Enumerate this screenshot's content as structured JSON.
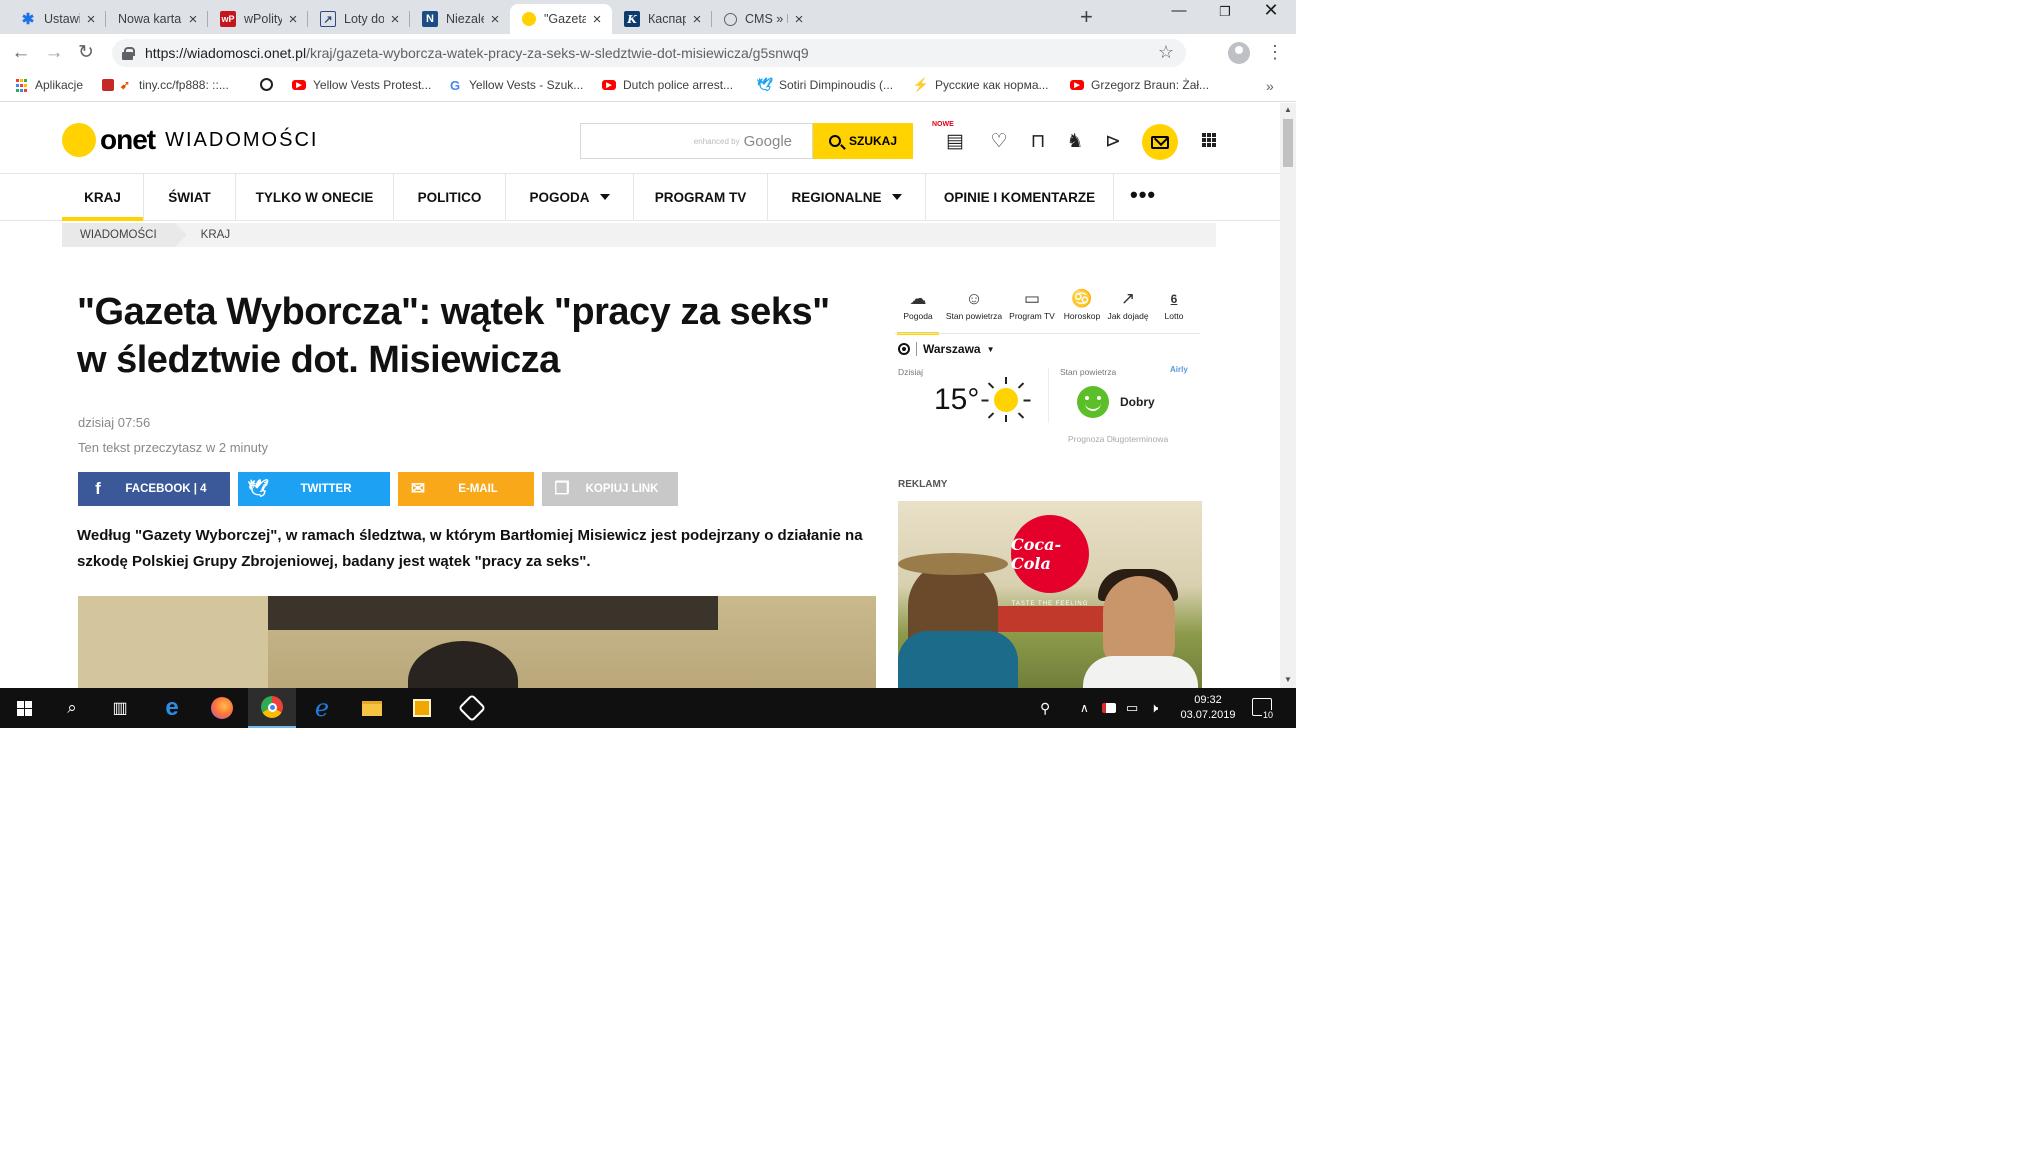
{
  "browser": {
    "tabs": [
      {
        "title": "Ustawienia",
        "icon": "gear-icon",
        "color": "#1a73e8"
      },
      {
        "title": "Nowa karta",
        "icon": "blank-icon",
        "color": "#ffffff"
      },
      {
        "title": "wPolityce.pl",
        "icon": "wp-icon",
        "color": "#c4161c"
      },
      {
        "title": "Loty do Tokio",
        "icon": "flight-icon",
        "color": "#2d4b86"
      },
      {
        "title": "Niezależna",
        "icon": "n-icon",
        "color": "#1c4b85"
      },
      {
        "title": "\"Gazeta Wyborcza\"",
        "icon": "onet-icon",
        "color": "#ffd200"
      },
      {
        "title": "Каспаров.Ru",
        "icon": "k-icon",
        "color": "#0d3b6e"
      },
      {
        "title": "CMS » Dodaj",
        "icon": "globe-icon",
        "color": "#5f6368"
      }
    ],
    "active_tab": 5,
    "url_host": "https://wiadomosci.onet.pl",
    "url_path": "/kraj/gazeta-wyborcza-watek-pracy-za-seks-w-sledztwie-dot-misiewicza/g5snwq9",
    "bookmarks": [
      {
        "label": "Aplikacje",
        "icon": "apps-icon",
        "color": "#ea4335"
      },
      {
        "label": "tiny.cc/fp888: ::...",
        "icon": "bookmark-icon",
        "color": "#e65100"
      },
      {
        "label": "",
        "icon": "globe-icon",
        "color": "#202124"
      },
      {
        "label": "Yellow Vests Protest...",
        "icon": "youtube-icon",
        "color": "#ff0000"
      },
      {
        "label": "Yellow Vests - Szuk...",
        "icon": "google-icon",
        "color": "#4285f4"
      },
      {
        "label": "Dutch police arrest...",
        "icon": "youtube-icon",
        "color": "#ff0000"
      },
      {
        "label": "Sotiri Dimpinoudis (...",
        "icon": "twitter-icon",
        "color": "#1da1f2"
      },
      {
        "label": "Русские как норма...",
        "icon": "bookmark-icon",
        "color": "#f57c00"
      },
      {
        "label": "Grzegorz Braun: Żał...",
        "icon": "youtube-icon",
        "color": "#ff0000"
      }
    ]
  },
  "site": {
    "logo_word": "onet",
    "logo_section": "WIADOMOŚCI",
    "search_enhanced": "enhanced by",
    "search_google": "Google",
    "search_button": "SZUKAJ",
    "nowe_badge": "NOWE",
    "nav": [
      {
        "label": "KRAJ",
        "active": true,
        "dropdown": false
      },
      {
        "label": "ŚWIAT",
        "active": false,
        "dropdown": false
      },
      {
        "label": "TYLKO W ONECIE",
        "active": false,
        "dropdown": false
      },
      {
        "label": "POLITICO",
        "active": false,
        "dropdown": false
      },
      {
        "label": "POGODA",
        "active": false,
        "dropdown": true
      },
      {
        "label": "PROGRAM TV",
        "active": false,
        "dropdown": false
      },
      {
        "label": "REGIONALNE",
        "active": false,
        "dropdown": true
      },
      {
        "label": "OPINIE I KOMENTARZE",
        "active": false,
        "dropdown": false
      }
    ],
    "nav_more": "•••",
    "accent": "#ffd200"
  },
  "breadcrumb": [
    "WIADOMOŚCI",
    "KRAJ"
  ],
  "article": {
    "title": "\"Gazeta Wyborcza\": wątek \"pracy za seks\" w śledztwie dot. Misiewicza",
    "date": "dzisiaj 07:56",
    "read_time": "Ten tekst przeczytasz w 2 minuty",
    "share": {
      "facebook": "FACEBOOK | 4",
      "twitter": "TWITTER",
      "email": "E-MAIL",
      "copy": "KOPIUJ LINK"
    },
    "lead": "Według \"Gazety Wyborczej\", w ramach śledztwa, w którym Bartłomiej Misiewicz jest podejrzany o działanie na szkodę Polskiej Grupy Zbrojeniowej, badany jest wątek \"pracy za seks\"."
  },
  "widget": {
    "tabs": [
      {
        "label": "Pogoda",
        "icon": "weather-icon"
      },
      {
        "label": "Stan powietrza",
        "icon": "air-quality-icon"
      },
      {
        "label": "Program TV",
        "icon": "tv-icon"
      },
      {
        "label": "Horoskop",
        "icon": "horoscope-icon"
      },
      {
        "label": "Jak dojadę",
        "icon": "route-icon"
      },
      {
        "label": "Lotto",
        "icon": "lotto-icon"
      }
    ],
    "lotto_number": "6",
    "city": "Warszawa",
    "today_label": "Dzisiaj",
    "temperature": "15°",
    "air_label": "Stan powietrza",
    "air_value": "Dobry",
    "airly": "Airly",
    "forecast_link": "Prognoza Długoterminowa"
  },
  "ads": {
    "label": "REKLAMY",
    "brand": "Coca-Cola",
    "tagline": "TASTE THE FEELING"
  },
  "taskbar": {
    "time": "09:32",
    "date": "03.07.2019",
    "notifications": "10"
  }
}
